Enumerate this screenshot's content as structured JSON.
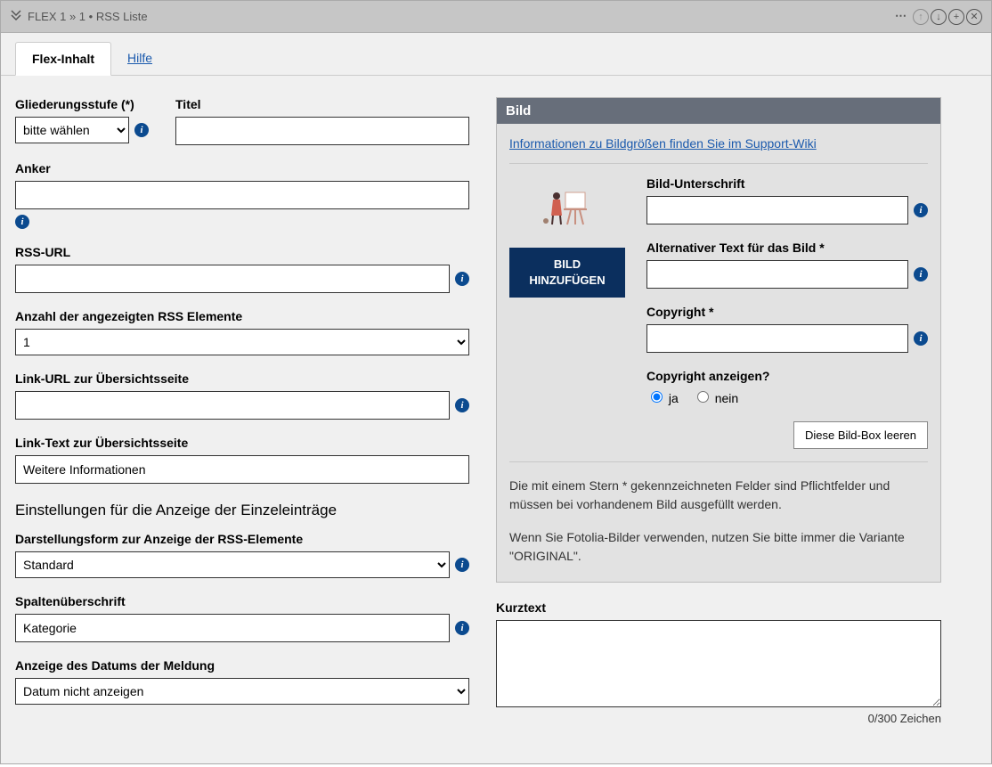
{
  "titlebar": {
    "text": "FLEX 1 »  1 • RSS Liste"
  },
  "tabs": {
    "active": "Flex-Inhalt",
    "help": "Hilfe"
  },
  "left": {
    "gliederungsstufe_label": "Gliederungsstufe (*)",
    "gliederungsstufe_value": "bitte wählen",
    "titel_label": "Titel",
    "titel_value": "",
    "anker_label": "Anker",
    "anker_value": "",
    "rssurl_label": "RSS-URL",
    "rssurl_value": "",
    "anzahl_label": "Anzahl der angezeigten RSS Elemente",
    "anzahl_value": "1",
    "linkurl_label": "Link-URL zur Übersichtsseite",
    "linkurl_value": "",
    "linktext_label": "Link-Text zur Übersichtsseite",
    "linktext_value": "Weitere Informationen",
    "section_heading": "Einstellungen für die Anzeige der Einzeleinträge",
    "darstellung_label": "Darstellungsform zur Anzeige der RSS-Elemente",
    "darstellung_value": "Standard",
    "spalte_label": "Spaltenüberschrift",
    "spalte_value": "Kategorie",
    "datum_label": "Anzeige des Datums der Meldung",
    "datum_value": "Datum nicht anzeigen"
  },
  "right": {
    "panel_title": "Bild",
    "info_link": "Informationen zu Bildgrößen finden Sie im Support-Wiki",
    "add_image_btn": "BILD HINZUFÜGEN",
    "caption_label": "Bild-Unterschrift",
    "caption_value": "",
    "alt_label": "Alternativer Text für das Bild *",
    "alt_value": "",
    "copyright_label": "Copyright *",
    "copyright_value": "",
    "show_copyright_label": "Copyright anzeigen?",
    "radio_yes": "ja",
    "radio_no": "nein",
    "clear_btn": "Diese Bild-Box leeren",
    "help1": "Die mit einem Stern * gekennzeichneten Felder sind Pflichtfelder und müssen bei vorhandenem Bild ausgefüllt werden.",
    "help2": "Wenn Sie Fotolia-Bilder verwenden, nutzen Sie bitte immer die Variante \"ORIGINAL\".",
    "kurztext_label": "Kurztext",
    "kurztext_value": "",
    "char_count": "0/300 Zeichen"
  }
}
